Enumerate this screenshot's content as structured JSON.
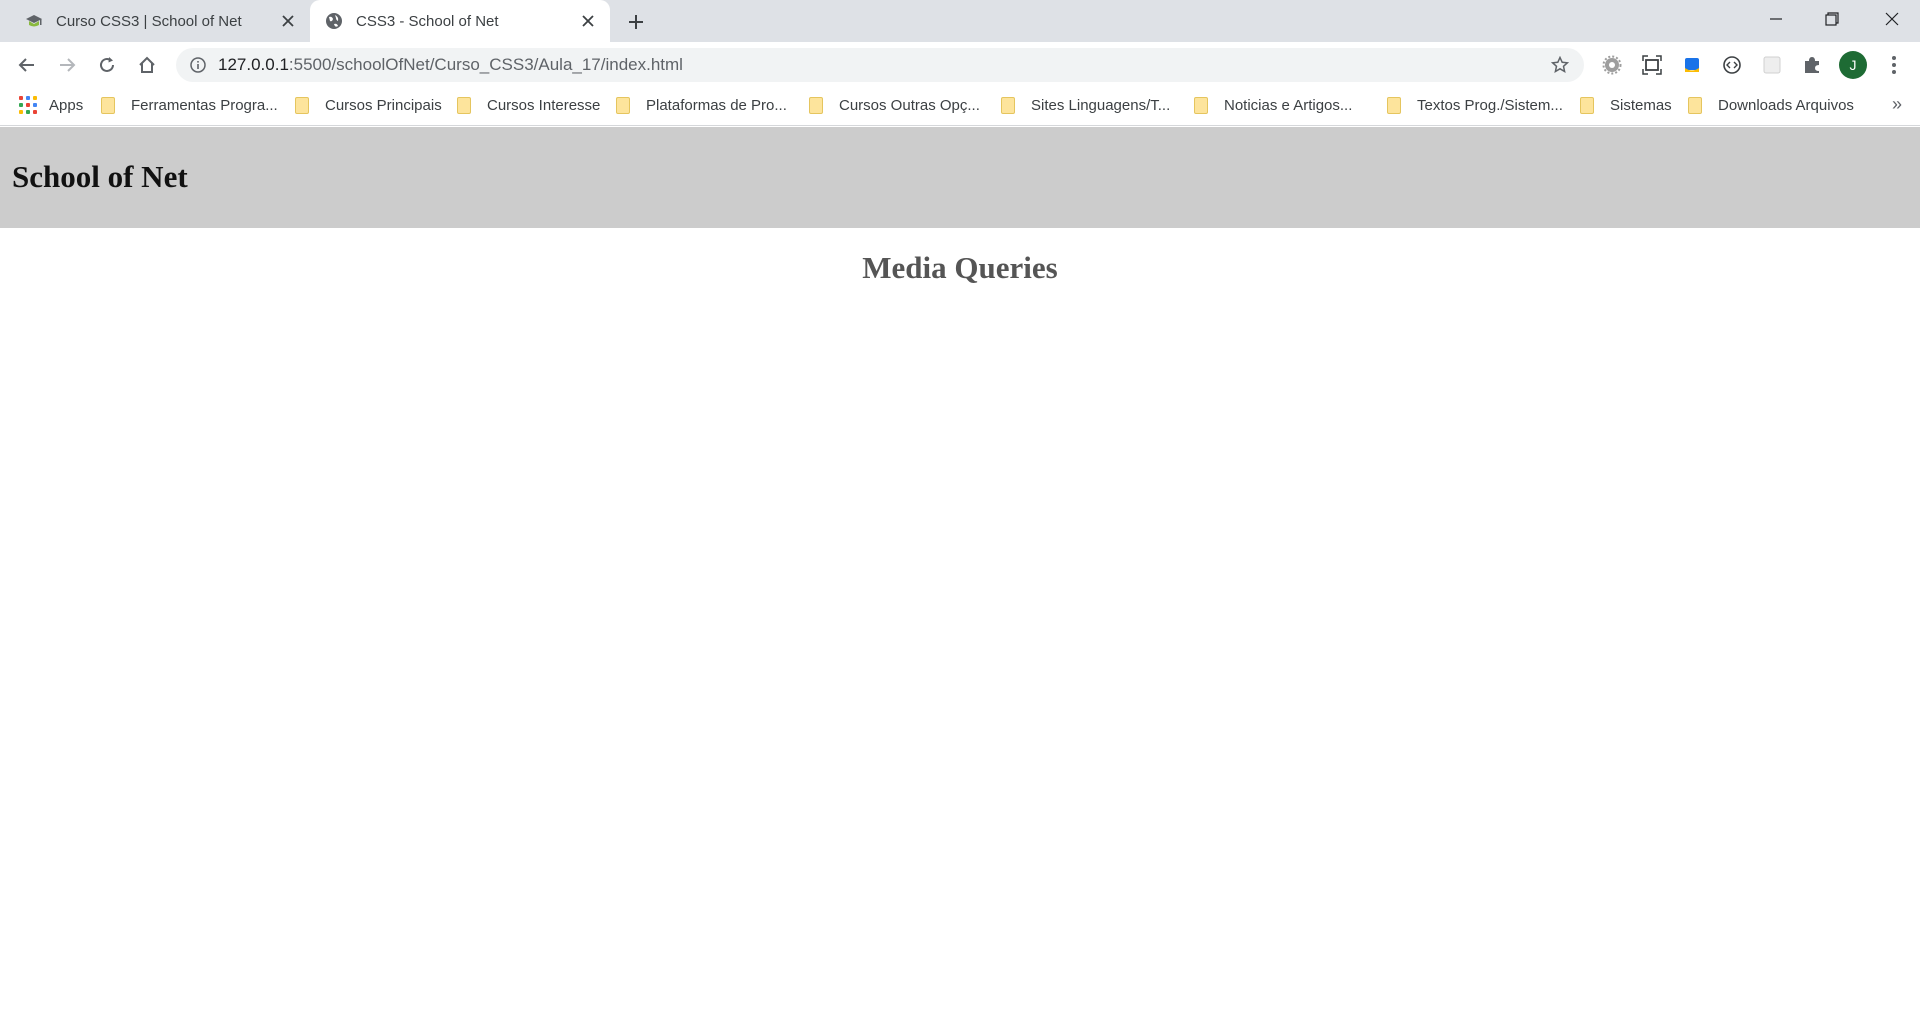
{
  "browser": {
    "tabs": [
      {
        "title": "Curso CSS3 | School of Net",
        "active": false
      },
      {
        "title": "CSS3 - School of Net",
        "active": true
      }
    ],
    "url": {
      "host": "127.0.0.1",
      "path": ":5500/schoolOfNet/Curso_CSS3/Aula_17/index.html"
    },
    "profile_initial": "J",
    "accent_color": "#1e6b34"
  },
  "bookmarks": {
    "apps_label": "Apps",
    "items": [
      "Ferramentas Progra...",
      "Cursos Principais",
      "Cursos Interesse",
      "Plataformas de Pro...",
      "Cursos Outras Opç...",
      "Sites Linguagens/T...",
      "Noticias e Artigos...",
      "Textos Prog./Sistem...",
      "Sistemas",
      "Downloads Arquivos"
    ],
    "more": "»"
  },
  "page": {
    "header_title": "School of Net",
    "main_heading": "Media Queries",
    "header_bg": "#cccccc",
    "heading_color": "#555555"
  }
}
